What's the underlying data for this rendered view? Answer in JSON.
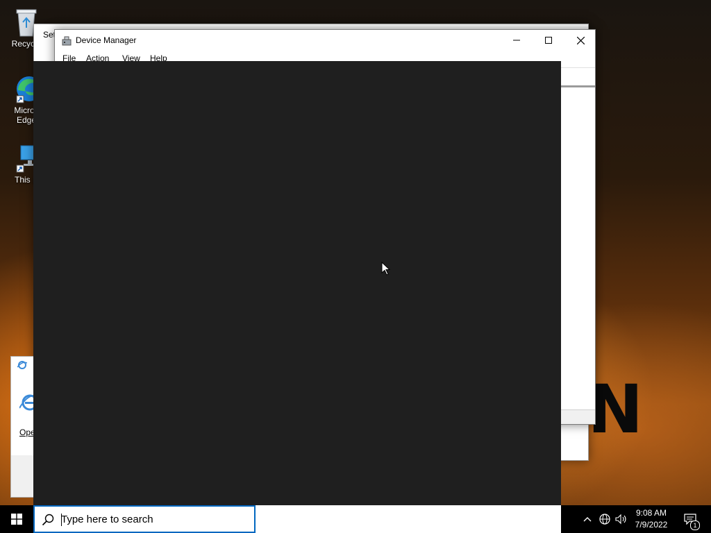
{
  "desktop": {
    "icons": [
      {
        "label": "Recycle",
        "icon": "recycle-bin-icon"
      },
      {
        "label": "Micros",
        "label2": "Edge",
        "icon": "edge-icon"
      },
      {
        "label": "This P",
        "icon": "this-pc-icon"
      }
    ],
    "background_letter": "N"
  },
  "settings_window": {
    "title": "Set"
  },
  "device_manager": {
    "title": "Device Manager",
    "controls": {
      "minimize": "minimize-icon",
      "maximize": "maximize-icon",
      "close": "close-icon"
    },
    "menu": [
      "File",
      "Action",
      "View",
      "Help"
    ]
  },
  "ie_window": {
    "open_label": "Ope"
  },
  "taskbar": {
    "search_placeholder": "Type here to search",
    "clock": {
      "time": "9:08 AM",
      "date": "7/9/2022"
    },
    "notification_count": "1",
    "tray_icons": [
      "chevron-up-icon",
      "network-icon",
      "volume-icon",
      "notifications-icon"
    ]
  },
  "colors": {
    "dark_overlay": "#1f1f1f",
    "search_border": "#0067c0",
    "taskbar": "#000000"
  }
}
